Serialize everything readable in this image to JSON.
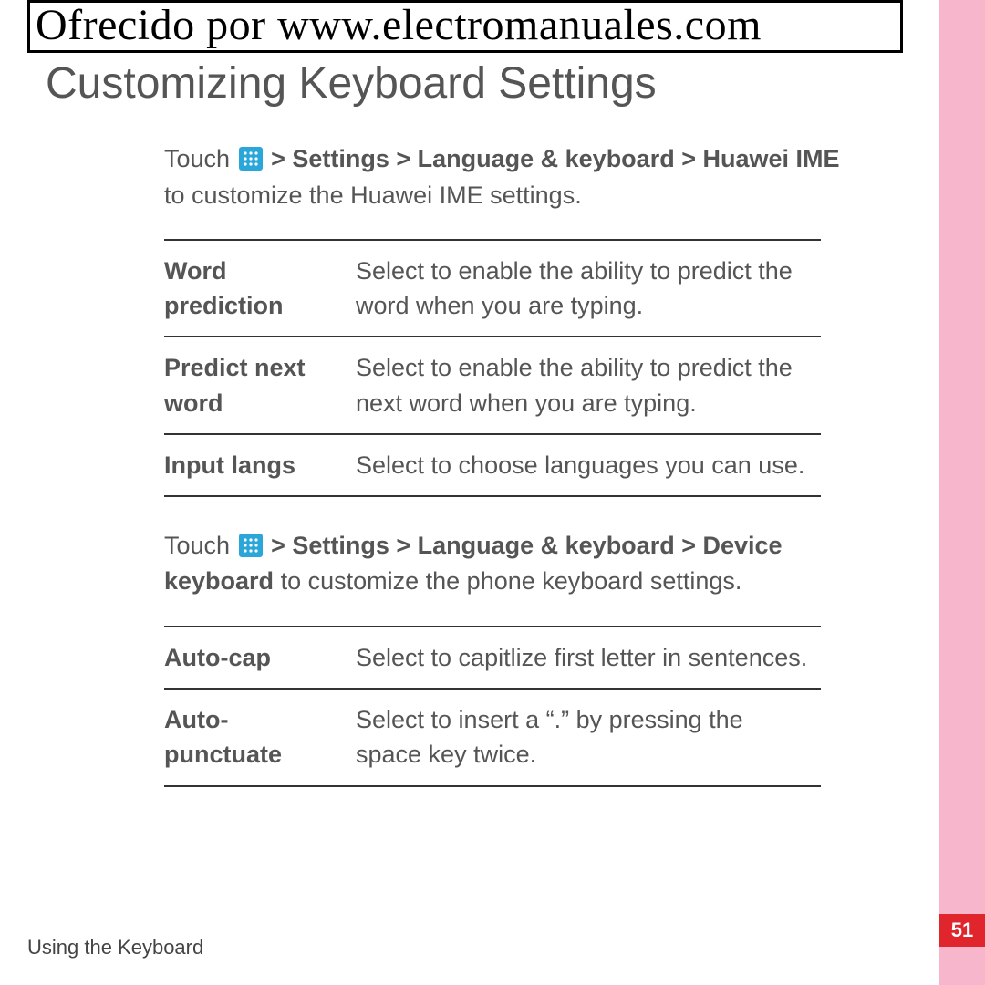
{
  "banner": "Ofrecido por www.electromanuales.com",
  "title": "Customizing Keyboard Settings",
  "intro1": {
    "prefix": "Touch ",
    "path": " > Settings > Language & keyboard > Huawei IME",
    "suffix": " to customize the Huawei IME settings."
  },
  "table1": [
    {
      "term": "Word prediction",
      "desc": "Select to enable the ability to predict the word when you are typing."
    },
    {
      "term": "Predict next word",
      "desc": "Select to enable the ability to predict the next word when you are typing."
    },
    {
      "term": "Input langs",
      "desc": "Select to choose languages you can use."
    }
  ],
  "intro2": {
    "prefix": "Touch ",
    "path": " > Settings > Language & keyboard > Device keyboard",
    "suffix": " to customize the phone keyboard settings."
  },
  "table2": [
    {
      "term": "Auto-cap",
      "desc": "Select to capitlize first letter in sentences."
    },
    {
      "term": "Auto-punctuate",
      "desc": "Select to insert a “.” by pressing the space key twice."
    }
  ],
  "footer": "Using the Keyboard",
  "pageNumber": "51"
}
